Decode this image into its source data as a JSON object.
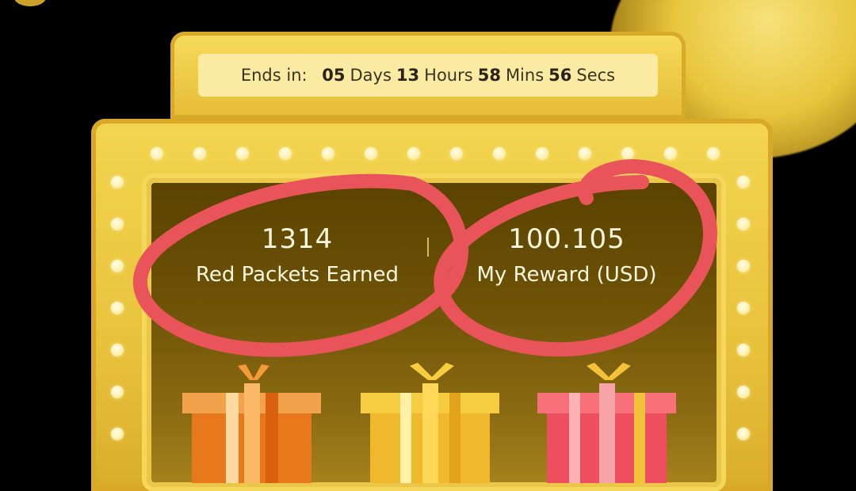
{
  "countdown": {
    "prefix": "Ends in:",
    "days_value": "05",
    "days_unit": "Days",
    "hours_value": "13",
    "hours_unit": "Hours",
    "mins_value": "58",
    "mins_unit": "Mins",
    "secs_value": "56",
    "secs_unit": "Secs"
  },
  "stats": {
    "red_packets": {
      "value": "1314",
      "label": "Red Packets Earned"
    },
    "reward": {
      "value": "100.105",
      "label": "My Reward (USD)"
    }
  },
  "gifts": [
    {
      "name": "orange-gift-box-icon",
      "color": "#f08a2a"
    },
    {
      "name": "yellow-gift-box-icon",
      "color": "#f2c53a"
    },
    {
      "name": "red-gift-box-icon",
      "color": "#f05a66"
    }
  ],
  "annotation_color": "#e8545a"
}
